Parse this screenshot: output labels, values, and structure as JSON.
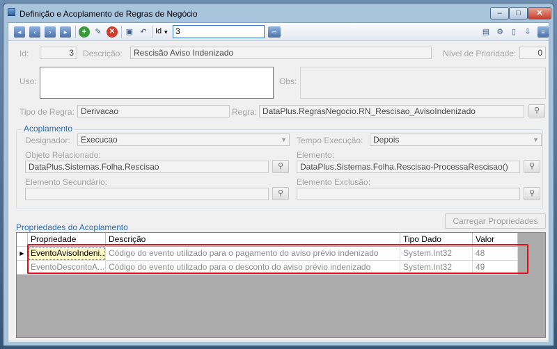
{
  "window": {
    "title": "Definição e Acoplamento de Regras de Negócio",
    "min_glyph": "–",
    "max_glyph": "□",
    "close_glyph": "✕"
  },
  "toolbar": {
    "id_label": "Id",
    "id_dropdown_glyph": "▾",
    "id_value": "3"
  },
  "form": {
    "id_label": "Id:",
    "id_value": "3",
    "descricao_label": "Descrição:",
    "descricao_value": "Rescisão Aviso Indenizado",
    "prioridade_label": "Nível de Prioridade:",
    "prioridade_value": "0",
    "uso_label": "Uso:",
    "uso_value": "",
    "obs_label": "Obs:",
    "obs_value": "",
    "tipo_regra_label": "Tipo de Regra:",
    "tipo_regra_value": "Derivacao",
    "regra_label": "Regra:",
    "regra_value": "DataPlus.RegrasNegocio.RN_Rescisao_AvisoIndenizado"
  },
  "acoplamento": {
    "title": "Acoplamento",
    "designador_label": "Designador:",
    "designador_value": "Execucao",
    "tempo_label": "Tempo Execução:",
    "tempo_value": "Depois",
    "objeto_label": "Objeto Relacionado:",
    "objeto_value": "DataPlus.Sistemas.Folha.Rescisao",
    "elemento_label": "Elemento:",
    "elemento_value": "DataPlus.Sistemas.Folha.Rescisao-ProcessaRescisao()",
    "secundario_label": "Elemento Secundário:",
    "secundario_value": "",
    "exclusao_label": "Elemento Exclusão:",
    "exclusao_value": ""
  },
  "propriedades": {
    "title": "Propriedades do Acoplamento",
    "load_button": "Carregar Propriedades",
    "columns": [
      "Propriedade",
      "Descrição",
      "Tipo Dado",
      "Valor"
    ],
    "rows": [
      {
        "propriedade": "EventoAvisoIndeni...",
        "descricao": "Código do evento utilizado para o pagamento do aviso prévio indenizado",
        "tipo": "System.Int32",
        "valor": "48"
      },
      {
        "propriedade": "EventoDescontoA...",
        "descricao": "Código do evento utilizado para o desconto do aviso prévio indenizado",
        "tipo": "System.Int32",
        "valor": "49"
      }
    ],
    "current_row_glyph": "▶"
  },
  "icons": {
    "lookup": "binoculars-icon",
    "combo": "chevron-down-icon"
  },
  "colors": {
    "accent": "#2a6ebb",
    "highlight": "#e0101a",
    "selected_cell": "#fff8c8"
  }
}
